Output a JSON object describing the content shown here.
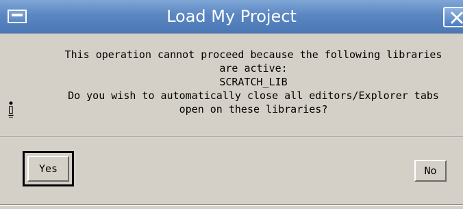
{
  "window": {
    "title": "Load My Project"
  },
  "message": {
    "lines": [
      "This operation cannot proceed because the following libraries",
      "are active:",
      "SCRATCH_LIB",
      "Do you wish to automatically close all editors/Explorer tabs",
      "open on these libraries?"
    ],
    "icon": "info-icon"
  },
  "buttons": {
    "yes_label": "Yes",
    "no_label": "No",
    "default": "yes"
  },
  "colors": {
    "titlebar": "#5b87c1",
    "dialog_bg": "#d4d0c8"
  }
}
